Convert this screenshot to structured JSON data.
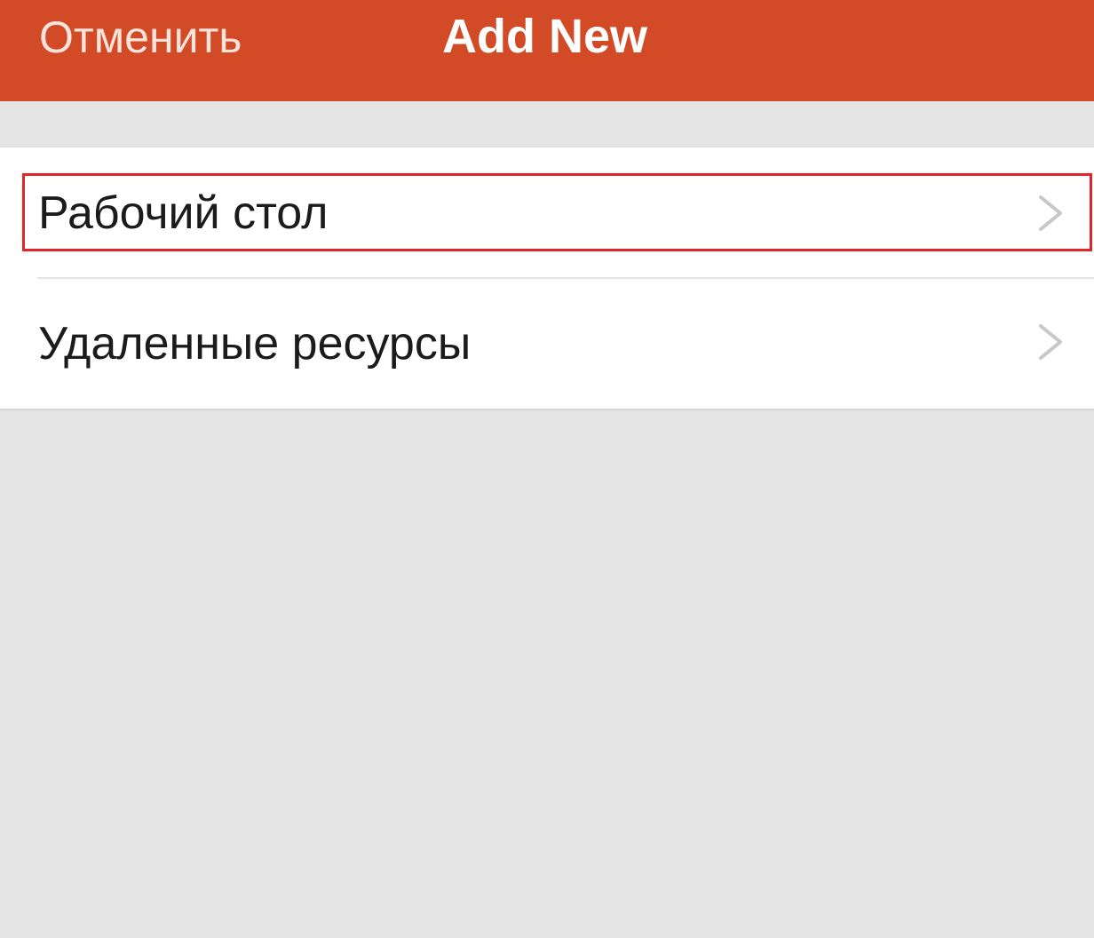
{
  "navbar": {
    "cancel_label": "Отменить",
    "title": "Add New",
    "background_color": "#d24a26"
  },
  "list": {
    "items": [
      {
        "label": "Рабочий стол",
        "icon": "chevron-right-icon",
        "highlighted": true
      },
      {
        "label": "Удаленные ресурсы",
        "icon": "chevron-right-icon",
        "highlighted": false
      }
    ]
  },
  "highlight_color": "#e3242b"
}
